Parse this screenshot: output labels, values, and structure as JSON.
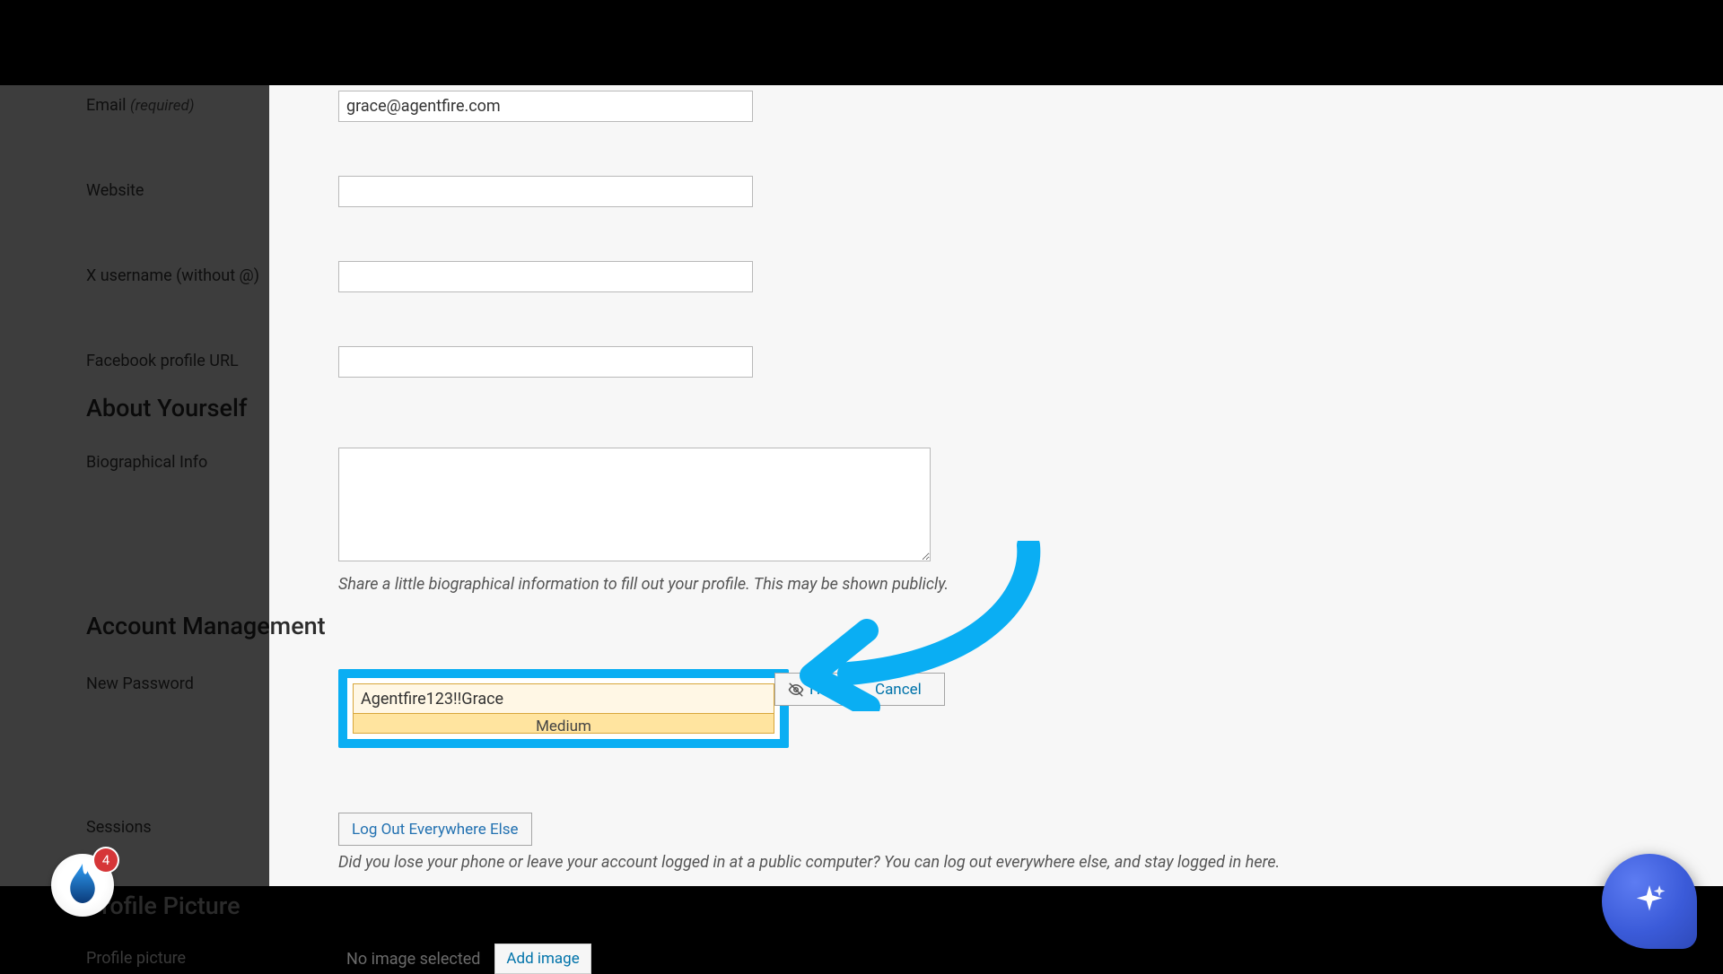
{
  "labels": {
    "email": "Email",
    "email_req": "(required)",
    "website": "Website",
    "x_username": "X username (without @)",
    "facebook": "Facebook profile URL",
    "bio": "Biographical Info",
    "new_password": "New Password",
    "sessions": "Sessions",
    "profile_picture_label": "Profile picture"
  },
  "headings": {
    "about": "About Yourself",
    "account": "Account Management",
    "profile_picture": "Profile Picture"
  },
  "values": {
    "email": "grace@agentfire.com",
    "website": "",
    "x_username": "",
    "facebook": "",
    "bio": "",
    "password": "Agentfire123!!Grace",
    "no_image": "No image selected"
  },
  "hints": {
    "bio": "Share a little biographical information to fill out your profile. This may be shown publicly.",
    "sessions": "Did you lose your phone or leave your account logged in at a public computer? You can log out everywhere else, and stay logged in here."
  },
  "password": {
    "strength": "Medium",
    "hide_label": "Hide",
    "cancel_label": "Cancel"
  },
  "buttons": {
    "logout_everywhere": "Log Out Everywhere Else",
    "add_image": "Add image"
  },
  "widgets": {
    "flame_badge": "4"
  }
}
